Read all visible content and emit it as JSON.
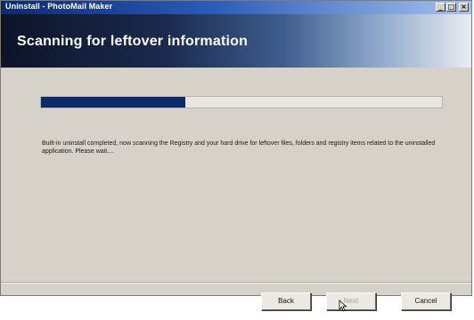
{
  "window": {
    "title": "Uninstall - PhotoMail Maker",
    "controls": {
      "minimize": "_",
      "maximize": "□",
      "close": "×"
    }
  },
  "header": {
    "title": "Scanning for leftover information"
  },
  "progress": {
    "value_fraction": 0.36
  },
  "message": {
    "text": "Built-in uninstall completed, now scanning the Registry and your hard drive for leftover files, folders and registry items related to the uninstalled application. Please wait...."
  },
  "buttons": {
    "back": "Back",
    "next": "Next",
    "cancel": "Cancel"
  },
  "icons": {
    "cursor": "mouse-pointer-icon"
  }
}
